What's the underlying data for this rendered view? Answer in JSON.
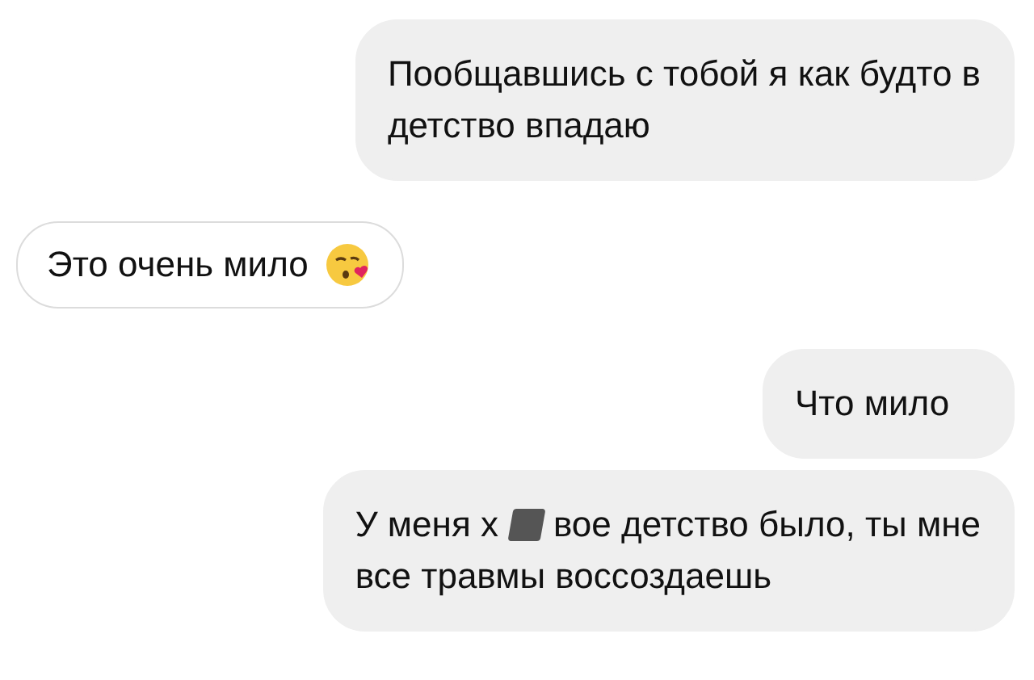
{
  "messages": [
    {
      "outgoing": true,
      "lines": [
        [
          {
            "kind": "text",
            "text": "Пообщавшись с тобой я как будто в"
          }
        ],
        [
          {
            "kind": "text",
            "text": "детство впадаю"
          }
        ]
      ]
    },
    {
      "outgoing": false,
      "lines": [
        [
          {
            "kind": "text",
            "text": "Это очень мило"
          },
          {
            "kind": "emoji"
          }
        ]
      ]
    },
    {
      "outgoing": true,
      "lines": [
        [
          {
            "kind": "text",
            "text": "Что мило"
          }
        ]
      ]
    },
    {
      "outgoing": true,
      "lines": [
        [
          {
            "kind": "text",
            "text": "У меня х"
          },
          {
            "kind": "redaction"
          },
          {
            "kind": "text",
            "text": "вое детство было, ты мне"
          }
        ],
        [
          {
            "kind": "text",
            "text": "все травмы воссоздаешь"
          }
        ]
      ]
    }
  ]
}
